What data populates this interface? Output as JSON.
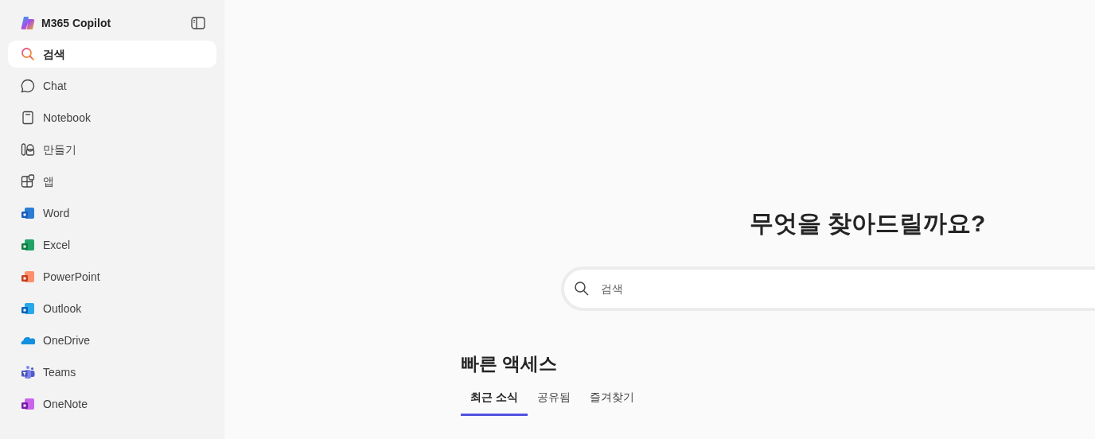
{
  "app": {
    "title": "M365 Copilot"
  },
  "sidebar": {
    "items": [
      {
        "label": "검색",
        "kind": "search",
        "selected": true
      },
      {
        "label": "Chat",
        "kind": "chat",
        "selected": false
      },
      {
        "label": "Notebook",
        "kind": "notebook",
        "selected": false
      },
      {
        "label": "만들기",
        "kind": "create",
        "selected": false
      },
      {
        "label": "앱",
        "kind": "apps",
        "selected": false
      },
      {
        "label": "Word",
        "kind": "word",
        "selected": false
      },
      {
        "label": "Excel",
        "kind": "excel",
        "selected": false
      },
      {
        "label": "PowerPoint",
        "kind": "powerpoint",
        "selected": false
      },
      {
        "label": "Outlook",
        "kind": "outlook",
        "selected": false
      },
      {
        "label": "OneDrive",
        "kind": "onedrive",
        "selected": false
      },
      {
        "label": "Teams",
        "kind": "teams",
        "selected": false
      },
      {
        "label": "OneNote",
        "kind": "onenote",
        "selected": false
      }
    ]
  },
  "main": {
    "heading": "무엇을 찾아드릴까요?",
    "search": {
      "placeholder": "검색"
    },
    "quick_access": {
      "title": "빠른 액세스",
      "tabs": [
        {
          "label": "최근 소식",
          "selected": true
        },
        {
          "label": "공유됨",
          "selected": false
        },
        {
          "label": "즐겨찾기",
          "selected": false
        }
      ]
    }
  }
}
